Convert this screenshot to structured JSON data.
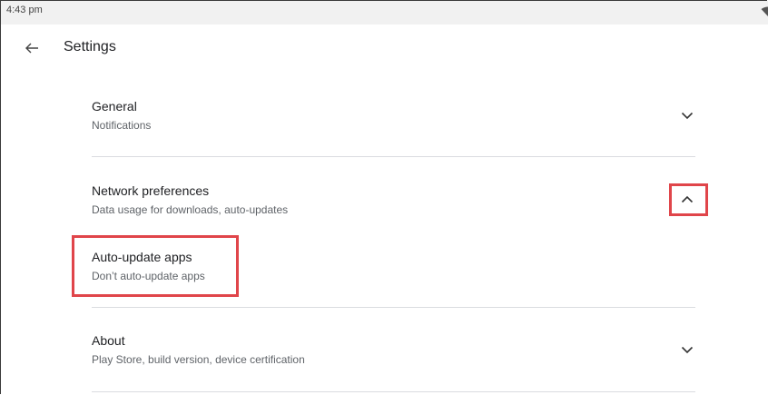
{
  "status_bar": {
    "time": "4:43 pm",
    "wifi_icon": "wifi-icon"
  },
  "header": {
    "back_icon": "arrow-back-icon",
    "title": "Settings"
  },
  "sections": [
    {
      "title": "General",
      "subtitle": "Notifications",
      "chevron": "chevron-down-icon"
    },
    {
      "title": "Network preferences",
      "subtitle": "Data usage for downloads, auto-updates",
      "chevron": "chevron-up-icon",
      "expanded": true,
      "children": [
        {
          "title": "Auto-update apps",
          "subtitle": "Don’t auto-update apps"
        }
      ]
    },
    {
      "title": "About",
      "subtitle": "Play Store, build version, device certification",
      "chevron": "chevron-down-icon"
    }
  ],
  "highlight_color": "#e0454a"
}
